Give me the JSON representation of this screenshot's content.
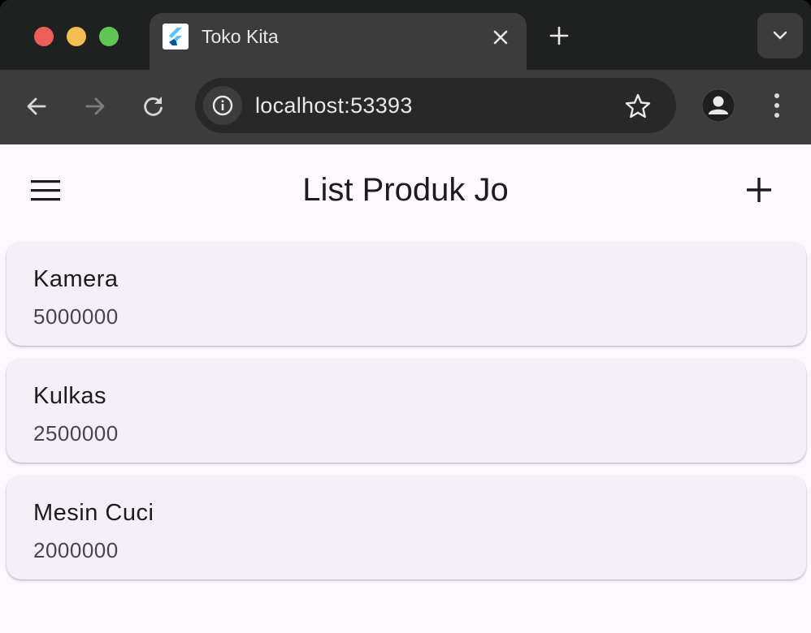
{
  "browser": {
    "tab": {
      "title": "Toko Kita",
      "favicon": "flutter-logo"
    },
    "url": "localhost:53393",
    "icons": {
      "back": "arrow-left-icon",
      "forward": "arrow-right-icon",
      "reload": "reload-icon",
      "info": "info-icon",
      "bookmark": "star-icon",
      "profile": "account-icon",
      "menu": "kebab-icon"
    }
  },
  "app": {
    "title": "List Produk Jo",
    "menu_icon": "hamburger-icon",
    "add_icon": "plus-icon",
    "products": [
      {
        "name": "Kamera",
        "price": "5000000"
      },
      {
        "name": "Kulkas",
        "price": "2500000"
      },
      {
        "name": "Mesin Cuci",
        "price": "2000000"
      }
    ]
  },
  "colors": {
    "app_background": "#fdf7ff",
    "card_background": "#f3f0f7",
    "browser_chrome": "#3c3c3c"
  }
}
